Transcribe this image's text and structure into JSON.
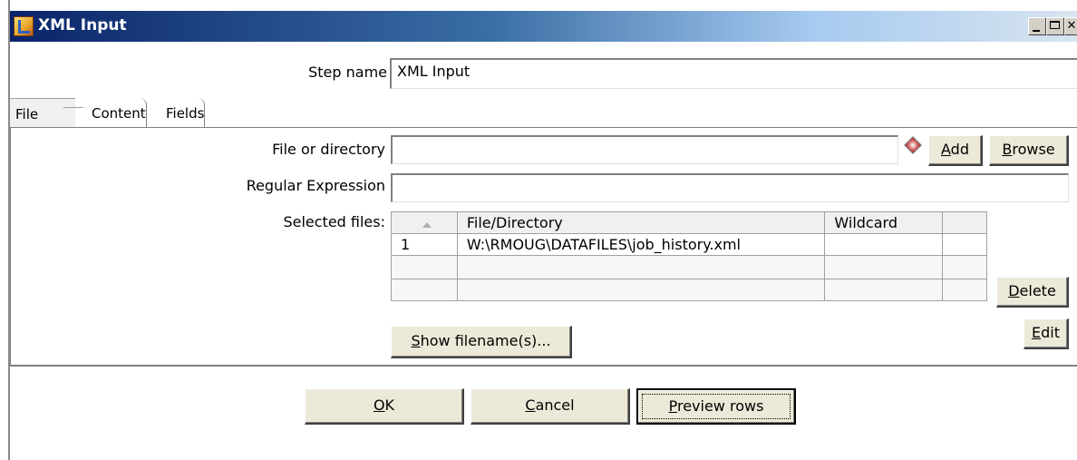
{
  "window": {
    "title": "XML Input",
    "icon": "kettle-app-icon"
  },
  "step": {
    "label": "Step name",
    "value": "XML Input"
  },
  "tabs": {
    "file": "File",
    "content": "Content",
    "fields": "Fields"
  },
  "file_tab": {
    "file_or_directory_label": "File or directory",
    "file_or_directory_value": "",
    "add_button_accel": "A",
    "add_button_rest": "dd",
    "browse_button_accel": "B",
    "browse_button_rest": "rowse",
    "regex_label": "Regular Expression",
    "regex_value": "",
    "selected_files_label": "Selected files:",
    "table_headers": {
      "file_directory": "File/Directory",
      "wildcard": "Wildcard"
    },
    "rows": [
      {
        "num": "1",
        "file": "W:\\RMOUG\\DATAFILES\\job_history.xml",
        "wildcard": ""
      }
    ],
    "delete_button_accel": "D",
    "delete_button_rest": "elete",
    "edit_button_accel": "E",
    "edit_button_rest": "dit",
    "show_filenames_accel": "S",
    "show_filenames_rest": "how filename(s)..."
  },
  "footer": {
    "ok_accel": "O",
    "ok_rest": "K",
    "cancel_accel": "C",
    "cancel_rest": "ancel",
    "preview_accel": "P",
    "preview_rest": "review rows"
  }
}
